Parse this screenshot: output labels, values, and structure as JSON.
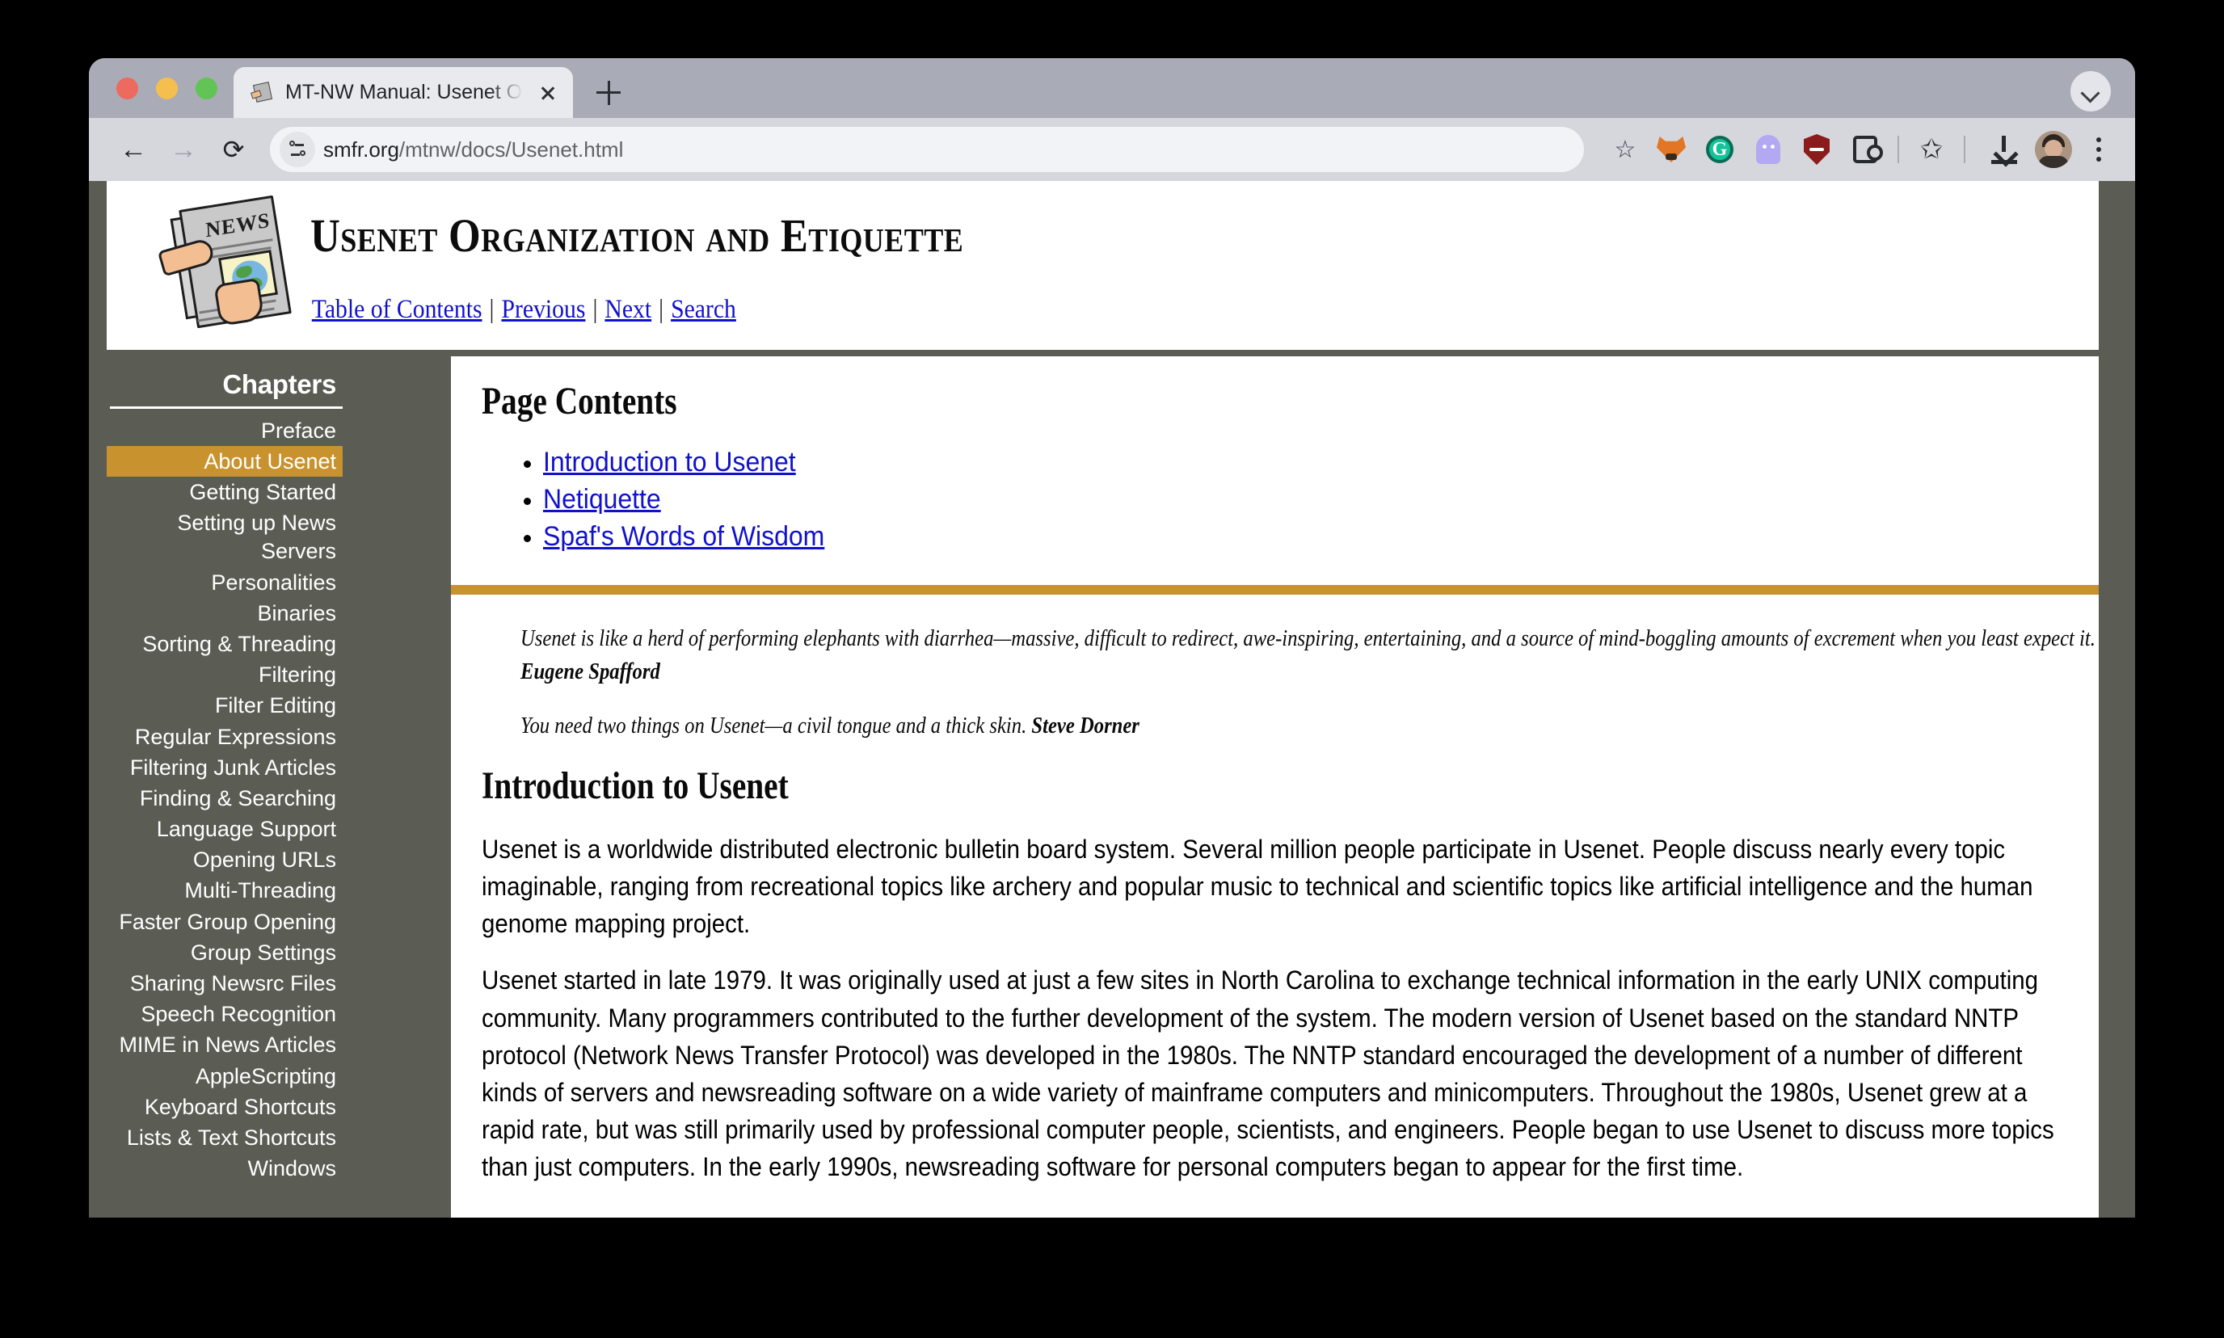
{
  "browser": {
    "tab": {
      "title": "MT-NW Manual: Usenet Orga",
      "favicon_name": "newspaper-favicon",
      "close_label": "×"
    },
    "new_tab_label": "+",
    "toolbar": {
      "back_glyph": "←",
      "forward_glyph": "→",
      "reload_glyph": "⟳",
      "url_host": "smfr.org",
      "url_path": "/mtnw/docs/Usenet.html",
      "bookmark_glyph": "☆",
      "extensions": [
        {
          "name": "metamask-extension-icon",
          "label": "MetaMask"
        },
        {
          "name": "grammarly-extension-icon",
          "label": "G"
        },
        {
          "name": "ghostery-extension-icon",
          "label": "Ghostery"
        },
        {
          "name": "ublock-extension-icon",
          "label": "uBlock Origin"
        },
        {
          "name": "extensions-puzzle-icon",
          "label": "Extensions"
        }
      ],
      "bookmarks_star_glyph": "✩",
      "menu_glyph": "⋮"
    }
  },
  "header": {
    "logo_name": "newspaper-logo",
    "logo_text": "NEWS",
    "title": "Usenet Organization and Etiquette",
    "nav": [
      {
        "label": "Table of Contents"
      },
      {
        "label": "Previous"
      },
      {
        "label": "Next"
      },
      {
        "label": "Search"
      }
    ],
    "nav_separator": "|"
  },
  "sidebar": {
    "heading": "Chapters",
    "active_item": "About Usenet",
    "items": [
      {
        "label": "Preface"
      },
      {
        "label": "About Usenet"
      },
      {
        "label": "Getting Started"
      },
      {
        "label": "Setting up News Servers"
      },
      {
        "label": "Personalities"
      },
      {
        "label": "Binaries"
      },
      {
        "label": "Sorting & Threading"
      },
      {
        "label": "Filtering"
      },
      {
        "label": "Filter Editing"
      },
      {
        "label": "Regular Expressions"
      },
      {
        "label": "Filtering Junk Articles"
      },
      {
        "label": "Finding & Searching"
      },
      {
        "label": "Language Support"
      },
      {
        "label": "Opening URLs"
      },
      {
        "label": "Multi-Threading"
      },
      {
        "label": "Faster Group Opening"
      },
      {
        "label": "Group Settings"
      },
      {
        "label": "Sharing Newsrc Files"
      },
      {
        "label": "Speech Recognition"
      },
      {
        "label": "MIME in News Articles"
      },
      {
        "label": "AppleScripting"
      },
      {
        "label": "Keyboard Shortcuts"
      },
      {
        "label": "Lists & Text Shortcuts"
      },
      {
        "label": "Windows"
      }
    ]
  },
  "content": {
    "page_contents_heading": "Page Contents",
    "toc": [
      {
        "label": "Introduction to Usenet"
      },
      {
        "label": "Netiquette"
      },
      {
        "label": "Spaf's Words of Wisdom"
      }
    ],
    "quotes": [
      {
        "text": "Usenet is like a herd of performing elephants with diarrhea—massive, difficult to redirect, awe-inspiring, entertaining, and a source of mind-boggling amounts of excrement when you least expect it.",
        "author": "Eugene Spafford"
      },
      {
        "text": "You need two things on Usenet—a civil tongue and a thick skin.",
        "author": "Steve Dorner"
      }
    ],
    "section_heading": "Introduction to Usenet",
    "paragraphs": [
      "Usenet is a worldwide distributed electronic bulletin board system. Several million people participate in Usenet. People discuss nearly every topic imaginable, ranging from recreational topics like archery and popular music to technical and scientific topics like artificial intelligence and the human genome mapping project.",
      "Usenet started in late 1979. It was originally used at just a few sites in North Carolina to exchange technical information in the early UNIX computing community. Many programmers contributed to the further development of the system. The modern version of Usenet based on the standard NNTP protocol (Network News Transfer Protocol) was developed in the 1980s. The NNTP standard encouraged the development of a number of different kinds of servers and newsreading software on a wide variety of mainframe computers and minicomputers. Throughout the 1980s, Usenet grew at a rapid rate, but was still primarily used by professional computer people, scientists, and engineers. People began to use Usenet to discuss more topics than just computers. In the early 1990s, newsreading software for personal computers began to appear for the first time."
    ]
  },
  "colors": {
    "sidebar_bg": "#5b5c54",
    "accent_gold": "#c8932f",
    "link_blue": "#1111cc"
  }
}
